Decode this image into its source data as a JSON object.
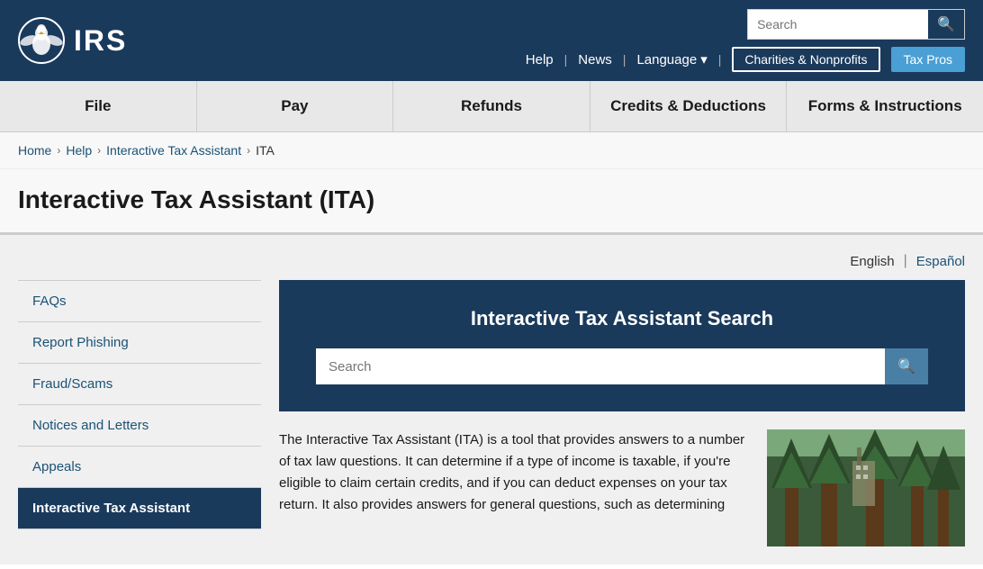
{
  "header": {
    "logo_text": "IRS",
    "search_placeholder": "Search",
    "top_nav": {
      "help": "Help",
      "news": "News",
      "language": "Language",
      "charities": "Charities & Nonprofits",
      "tax_pros": "Tax Pros"
    }
  },
  "nav": {
    "items": [
      {
        "label": "File",
        "id": "file"
      },
      {
        "label": "Pay",
        "id": "pay"
      },
      {
        "label": "Refunds",
        "id": "refunds"
      },
      {
        "label": "Credits & Deductions",
        "id": "credits"
      },
      {
        "label": "Forms & Instructions",
        "id": "forms"
      }
    ]
  },
  "breadcrumb": {
    "home": "Home",
    "help": "Help",
    "ita": "Interactive Tax Assistant",
    "current": "ITA"
  },
  "page_title": "Interactive Tax Assistant (ITA)",
  "lang_switcher": {
    "current": "English",
    "other": "Español"
  },
  "sidebar": {
    "items": [
      {
        "label": "FAQs",
        "id": "faqs",
        "active": false
      },
      {
        "label": "Report Phishing",
        "id": "phishing",
        "active": false
      },
      {
        "label": "Fraud/Scams",
        "id": "fraud",
        "active": false
      },
      {
        "label": "Notices and Letters",
        "id": "notices",
        "active": false
      },
      {
        "label": "Appeals",
        "id": "appeals",
        "active": false
      },
      {
        "label": "Interactive Tax Assistant",
        "id": "ita",
        "active": true
      }
    ]
  },
  "ita_search": {
    "title": "Interactive Tax Assistant Search",
    "placeholder": "Search"
  },
  "description": "The Interactive Tax Assistant (ITA) is a tool that provides answers to a number of tax law questions. It can determine if a type of income is taxable, if you're eligible to claim certain credits, and if you can deduct expenses on your tax return. It also provides answers for general questions, such as determining"
}
